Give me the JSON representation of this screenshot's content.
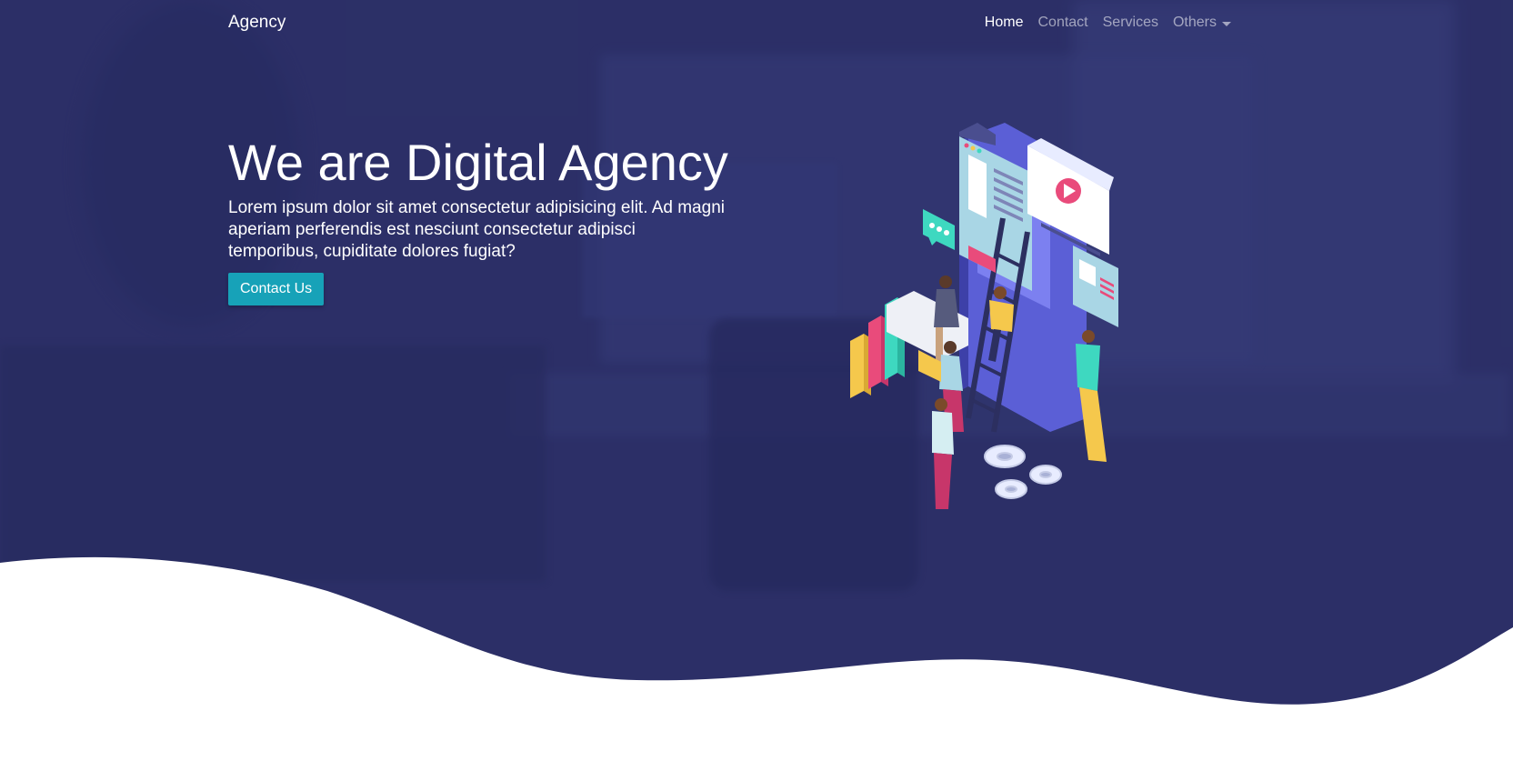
{
  "navbar": {
    "brand": "Agency",
    "links": [
      {
        "label": "Home",
        "active": true
      },
      {
        "label": "Contact",
        "active": false
      },
      {
        "label": "Services",
        "active": false
      },
      {
        "label": "Others",
        "active": false,
        "dropdown": true
      }
    ]
  },
  "hero": {
    "headline": "We are Digital Agency",
    "description": "Lorem ipsum dolor sit amet consectetur adipisicing elit. Ad magni aperiam perferendis est nesciunt consectetur adipisci temporibus, cupiditate dolores fugiat?",
    "cta_label": "Contact Us"
  },
  "colors": {
    "hero_background": "#2e3266",
    "cta": "#17a2b8",
    "illustration_accent_pink": "#e94b7b",
    "illustration_accent_teal": "#3ed8c0",
    "illustration_accent_yellow": "#f5c84c"
  },
  "icons": [
    "caret-down-icon",
    "play-icon",
    "chat-bubble-icon",
    "gear-icon"
  ]
}
